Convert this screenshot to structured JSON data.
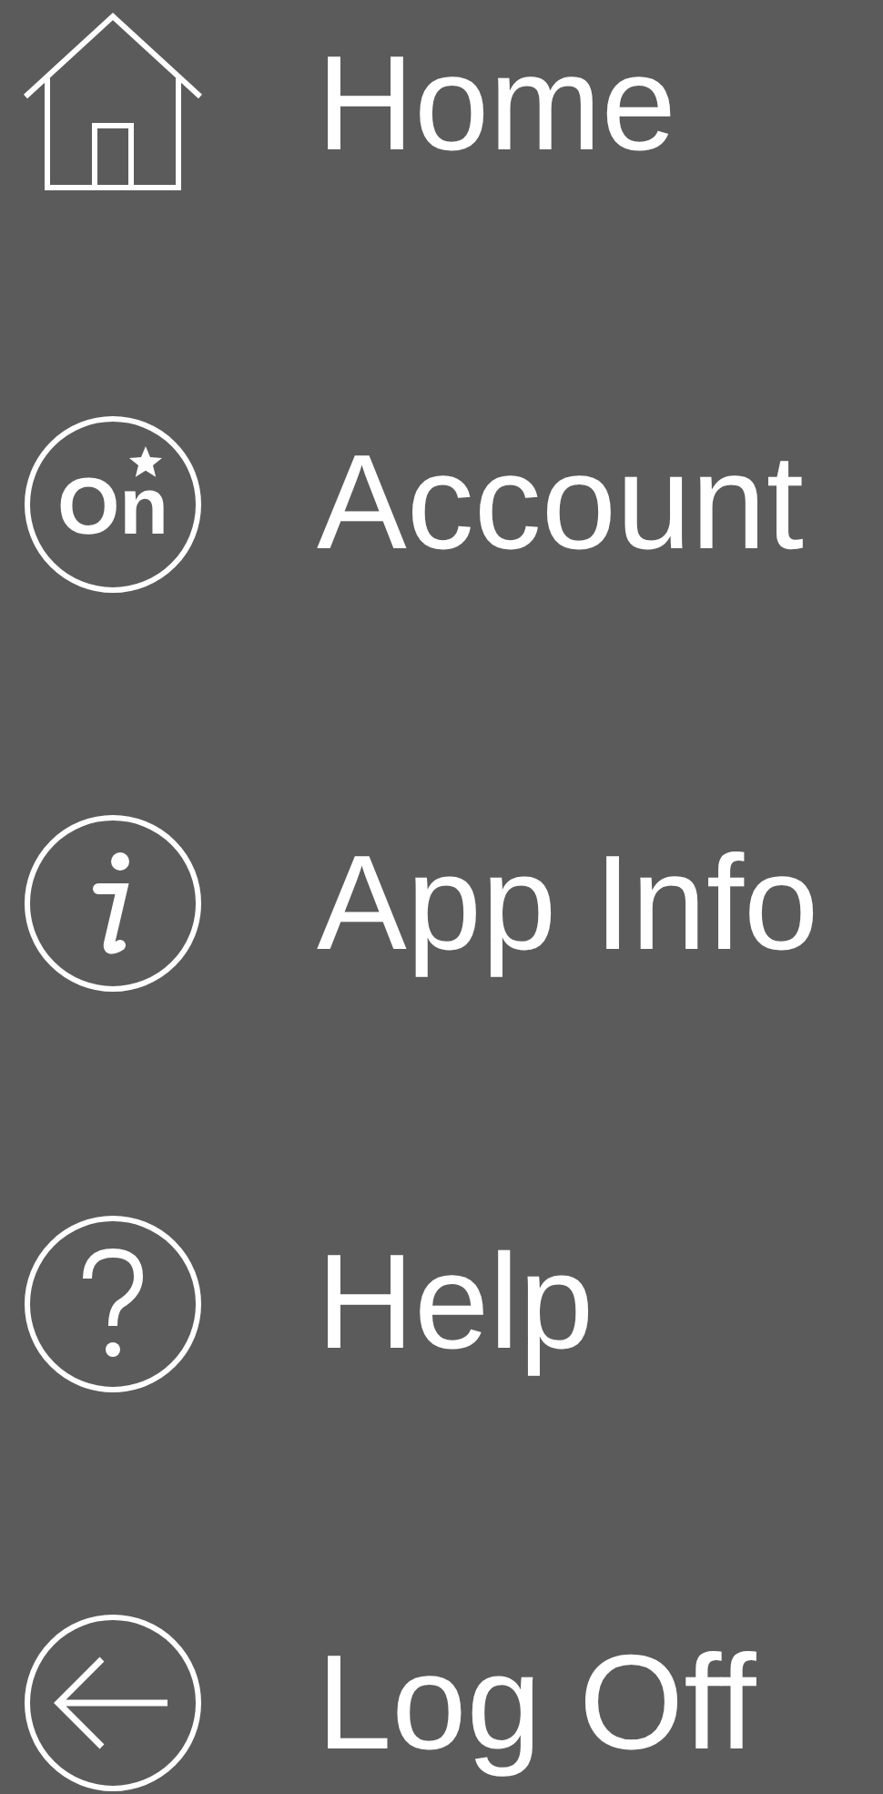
{
  "menu": {
    "items": [
      {
        "kind": "home",
        "label": "Home"
      },
      {
        "kind": "account",
        "label": "Account",
        "icon_text": "On"
      },
      {
        "kind": "info",
        "label": "App Info"
      },
      {
        "kind": "help",
        "label": "Help"
      },
      {
        "kind": "logoff",
        "label": "Log Off"
      }
    ]
  }
}
